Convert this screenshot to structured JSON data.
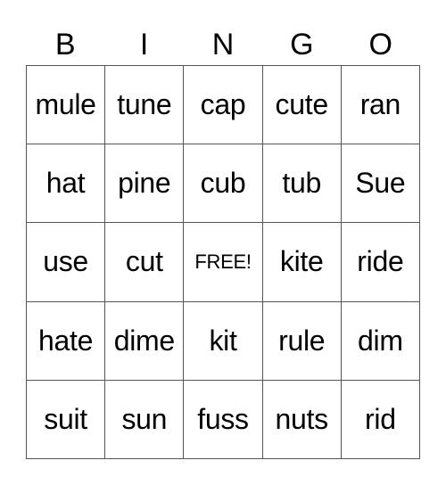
{
  "header": [
    "B",
    "I",
    "N",
    "G",
    "O"
  ],
  "rows": [
    [
      "mule",
      "tune",
      "cap",
      "cute",
      "ran"
    ],
    [
      "hat",
      "pine",
      "cub",
      "tub",
      "Sue"
    ],
    [
      "use",
      "cut",
      "FREE!",
      "kite",
      "ride"
    ],
    [
      "hate",
      "dime",
      "kit",
      "rule",
      "dim"
    ],
    [
      "suit",
      "sun",
      "fuss",
      "nuts",
      "rid"
    ]
  ],
  "free_label": "FREE!"
}
